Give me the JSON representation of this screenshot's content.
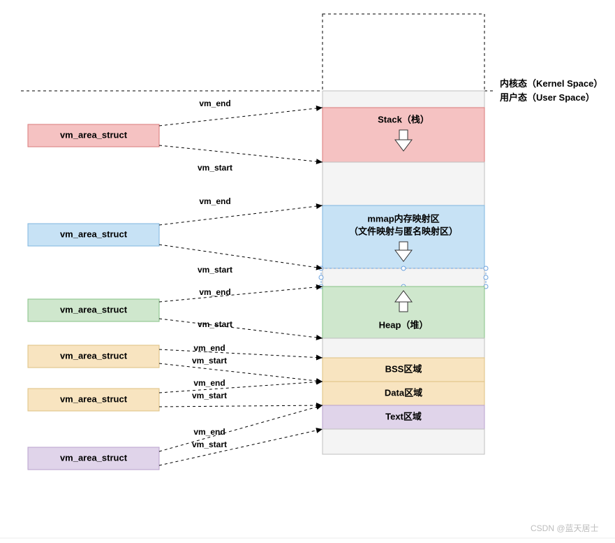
{
  "labels": {
    "kernel_space": "内核态（Kernel Space）",
    "user_space": "用户态（User Space）",
    "watermark": "CSDN @蓝天居士"
  },
  "connector_labels": {
    "vm_end": "vm_end",
    "vm_start": "vm_start"
  },
  "vmas": [
    {
      "label": "vm_area_struct",
      "fill": "#f5c2c2",
      "stroke": "#d97a7a"
    },
    {
      "label": "vm_area_struct",
      "fill": "#c7e2f5",
      "stroke": "#7fb6df"
    },
    {
      "label": "vm_area_struct",
      "fill": "#cfe7cd",
      "stroke": "#85c085"
    },
    {
      "label": "vm_area_struct",
      "fill": "#f8e4c0",
      "stroke": "#dec080"
    },
    {
      "label": "vm_area_struct",
      "fill": "#f8e4c0",
      "stroke": "#dec080"
    },
    {
      "label": "vm_area_struct",
      "fill": "#e0d4ea",
      "stroke": "#b9a0cc"
    }
  ],
  "regions": {
    "stack": {
      "label": "Stack（栈）",
      "fill": "#f5c2c2",
      "stroke": "#d97a7a"
    },
    "mmap": {
      "line1": "mmap内存映射区",
      "line2": "（文件映射与匿名映射区）",
      "fill": "#c7e2f5",
      "stroke": "#7fb6df"
    },
    "heap": {
      "label": "Heap（堆）",
      "fill": "#cfe7cd",
      "stroke": "#85c085"
    },
    "bss": {
      "label": "BSS区域",
      "fill": "#f8e4c0",
      "stroke": "#dec080"
    },
    "data": {
      "label": "Data区域",
      "fill": "#f8e4c0",
      "stroke": "#dec080"
    },
    "text": {
      "label": "Text区域",
      "fill": "#e0d4ea",
      "stroke": "#b9a0cc"
    }
  }
}
